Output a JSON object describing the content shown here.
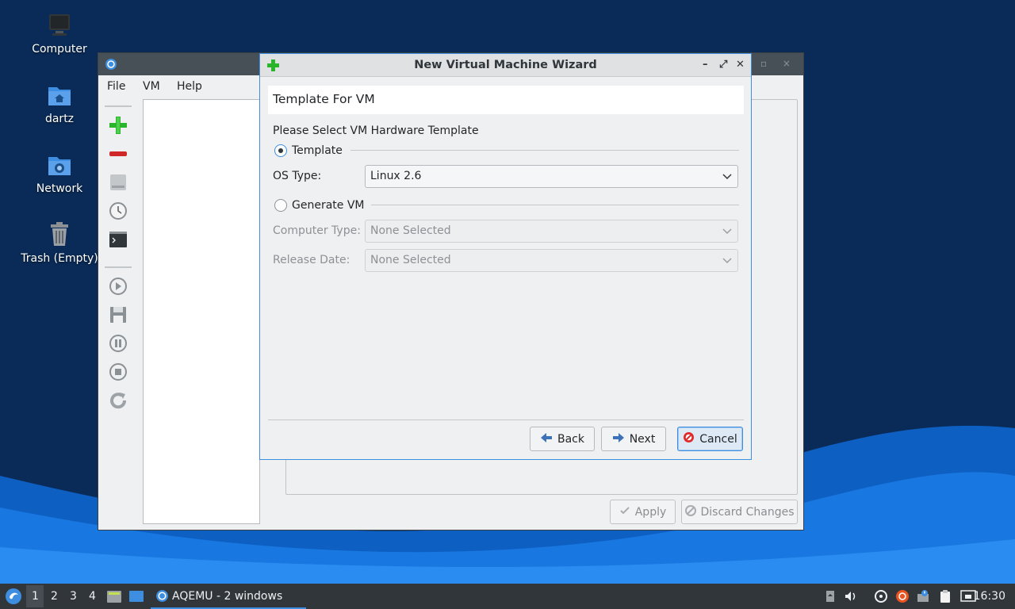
{
  "desktop": {
    "icons": [
      {
        "label": "Computer",
        "icon": "computer-icon"
      },
      {
        "label": "dartz",
        "icon": "home-folder-icon"
      },
      {
        "label": "Network",
        "icon": "network-folder-icon"
      },
      {
        "label": "Trash (Empty)",
        "icon": "trash-icon"
      }
    ]
  },
  "main_window": {
    "menu": [
      "File",
      "VM",
      "Help"
    ],
    "toolbar_icons": [
      "add-vm-icon",
      "remove-vm-icon",
      "hard-disk-icon",
      "clock-icon",
      "terminal-icon",
      "play-icon",
      "save-icon",
      "pause-icon",
      "stop-icon",
      "reload-icon"
    ],
    "apply_label": "Apply",
    "discard_label": "Discard Changes"
  },
  "wizard": {
    "title": "New Virtual Machine Wizard",
    "header": "Template For VM",
    "instruction": "Please Select VM Hardware Template",
    "template_option": "Template",
    "template_selected": true,
    "os_type_label": "OS Type:",
    "os_type_value": "Linux 2.6",
    "generate_option": "Generate VM",
    "computer_type_label": "Computer Type:",
    "computer_type_value": "None Selected",
    "release_date_label": "Release Date:",
    "release_date_value": "None Selected",
    "back_label": "Back",
    "next_label": "Next",
    "cancel_label": "Cancel"
  },
  "taskbar": {
    "workspaces": [
      "1",
      "2",
      "3",
      "4"
    ],
    "active_workspace": "1",
    "task_label": "AQEMU - 2 windows",
    "clock": "16:30"
  },
  "colors": {
    "accent": "#3d8ee0",
    "desktop_dark": "#0b2d5a",
    "desktop_wave": "#1a7de0",
    "taskbar": "#31363b"
  }
}
